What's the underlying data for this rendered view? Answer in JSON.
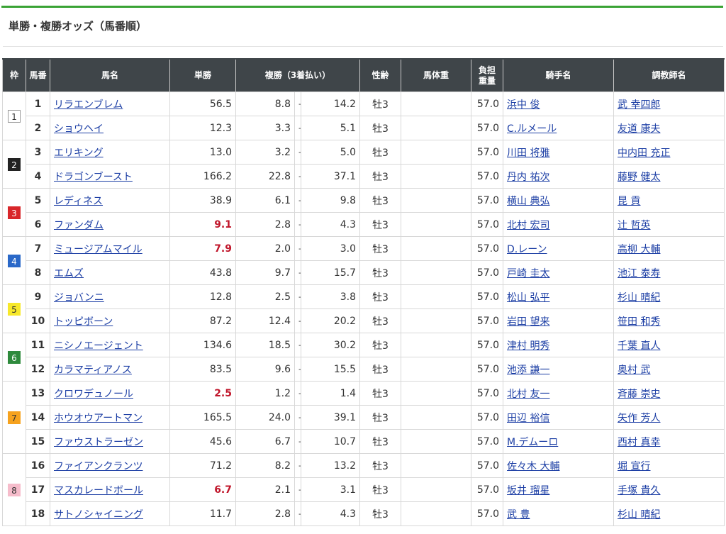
{
  "title": "単勝・複勝オッズ（馬番順）",
  "headers": {
    "waku": "枠",
    "umaban": "馬番",
    "name": "馬名",
    "tansho": "単勝",
    "fukusho": "複勝（3着払い）",
    "sexage": "性齢",
    "weight": "馬体重",
    "futan_1": "負担",
    "futan_2": "重量",
    "jockey": "騎手名",
    "trainer": "調教師名"
  },
  "fuku_separator": "-",
  "waku_colors": {
    "1": {
      "bg": "#ffffff",
      "fg": "#333333",
      "border": "#999999"
    },
    "2": {
      "bg": "#222222",
      "fg": "#ffffff",
      "border": "#222222"
    },
    "3": {
      "bg": "#d8262a",
      "fg": "#ffffff",
      "border": "#d8262a"
    },
    "4": {
      "bg": "#2a68c8",
      "fg": "#ffffff",
      "border": "#2a68c8"
    },
    "5": {
      "bg": "#f7e82a",
      "fg": "#333333",
      "border": "#f7e82a"
    },
    "6": {
      "bg": "#2e8a3c",
      "fg": "#ffffff",
      "border": "#2e8a3c"
    },
    "7": {
      "bg": "#f6a21e",
      "fg": "#333333",
      "border": "#f6a21e"
    },
    "8": {
      "bg": "#f6bccb",
      "fg": "#333333",
      "border": "#f6bccb"
    }
  },
  "accent_color": "#3aa335",
  "popular_color": "#c0152a",
  "rows": [
    {
      "waku": "1",
      "umaban": "1",
      "name": "リラエンブレム",
      "tansho": "56.5",
      "popular": false,
      "fuku_lo": "8.8",
      "fuku_hi": "14.2",
      "sexage": "牡3",
      "weight": "",
      "futan": "57.0",
      "jockey": "浜中 俊",
      "trainer": "武 幸四郎"
    },
    {
      "waku": "1",
      "umaban": "2",
      "name": "ショウヘイ",
      "tansho": "12.3",
      "popular": false,
      "fuku_lo": "3.3",
      "fuku_hi": "5.1",
      "sexage": "牡3",
      "weight": "",
      "futan": "57.0",
      "jockey": "C.ルメール",
      "trainer": "友道 康夫"
    },
    {
      "waku": "2",
      "umaban": "3",
      "name": "エリキング",
      "tansho": "13.0",
      "popular": false,
      "fuku_lo": "3.2",
      "fuku_hi": "5.0",
      "sexage": "牡3",
      "weight": "",
      "futan": "57.0",
      "jockey": "川田 将雅",
      "trainer": "中内田 充正"
    },
    {
      "waku": "2",
      "umaban": "4",
      "name": "ドラゴンブースト",
      "tansho": "166.2",
      "popular": false,
      "fuku_lo": "22.8",
      "fuku_hi": "37.1",
      "sexage": "牡3",
      "weight": "",
      "futan": "57.0",
      "jockey": "丹内 祐次",
      "trainer": "藤野 健太"
    },
    {
      "waku": "3",
      "umaban": "5",
      "name": "レディネス",
      "tansho": "38.9",
      "popular": false,
      "fuku_lo": "6.1",
      "fuku_hi": "9.8",
      "sexage": "牡3",
      "weight": "",
      "futan": "57.0",
      "jockey": "横山 典弘",
      "trainer": "昆 貢"
    },
    {
      "waku": "3",
      "umaban": "6",
      "name": "ファンダム",
      "tansho": "9.1",
      "popular": true,
      "fuku_lo": "2.8",
      "fuku_hi": "4.3",
      "sexage": "牡3",
      "weight": "",
      "futan": "57.0",
      "jockey": "北村 宏司",
      "trainer": "辻 哲英"
    },
    {
      "waku": "4",
      "umaban": "7",
      "name": "ミュージアムマイル",
      "tansho": "7.9",
      "popular": true,
      "fuku_lo": "2.0",
      "fuku_hi": "3.0",
      "sexage": "牡3",
      "weight": "",
      "futan": "57.0",
      "jockey": "D.レーン",
      "trainer": "高柳 大輔"
    },
    {
      "waku": "4",
      "umaban": "8",
      "name": "エムズ",
      "tansho": "43.8",
      "popular": false,
      "fuku_lo": "9.7",
      "fuku_hi": "15.7",
      "sexage": "牡3",
      "weight": "",
      "futan": "57.0",
      "jockey": "戸崎 圭太",
      "trainer": "池江 泰寿"
    },
    {
      "waku": "5",
      "umaban": "9",
      "name": "ジョバンニ",
      "tansho": "12.8",
      "popular": false,
      "fuku_lo": "2.5",
      "fuku_hi": "3.8",
      "sexage": "牡3",
      "weight": "",
      "futan": "57.0",
      "jockey": "松山 弘平",
      "trainer": "杉山 晴紀"
    },
    {
      "waku": "5",
      "umaban": "10",
      "name": "トッピボーン",
      "tansho": "87.2",
      "popular": false,
      "fuku_lo": "12.4",
      "fuku_hi": "20.2",
      "sexage": "牡3",
      "weight": "",
      "futan": "57.0",
      "jockey": "岩田 望来",
      "trainer": "笹田 和秀"
    },
    {
      "waku": "6",
      "umaban": "11",
      "name": "ニシノエージェント",
      "tansho": "134.6",
      "popular": false,
      "fuku_lo": "18.5",
      "fuku_hi": "30.2",
      "sexage": "牡3",
      "weight": "",
      "futan": "57.0",
      "jockey": "津村 明秀",
      "trainer": "千葉 直人"
    },
    {
      "waku": "6",
      "umaban": "12",
      "name": "カラマティアノス",
      "tansho": "83.5",
      "popular": false,
      "fuku_lo": "9.6",
      "fuku_hi": "15.5",
      "sexage": "牡3",
      "weight": "",
      "futan": "57.0",
      "jockey": "池添 謙一",
      "trainer": "奥村 武"
    },
    {
      "waku": "7",
      "umaban": "13",
      "name": "クロワデュノール",
      "tansho": "2.5",
      "popular": true,
      "fuku_lo": "1.2",
      "fuku_hi": "1.4",
      "sexage": "牡3",
      "weight": "",
      "futan": "57.0",
      "jockey": "北村 友一",
      "trainer": "斉藤 崇史"
    },
    {
      "waku": "7",
      "umaban": "14",
      "name": "ホウオウアートマン",
      "tansho": "165.5",
      "popular": false,
      "fuku_lo": "24.0",
      "fuku_hi": "39.1",
      "sexage": "牡3",
      "weight": "",
      "futan": "57.0",
      "jockey": "田辺 裕信",
      "trainer": "矢作 芳人"
    },
    {
      "waku": "7",
      "umaban": "15",
      "name": "ファウストラーゼン",
      "tansho": "45.6",
      "popular": false,
      "fuku_lo": "6.7",
      "fuku_hi": "10.7",
      "sexage": "牡3",
      "weight": "",
      "futan": "57.0",
      "jockey": "M.デムーロ",
      "trainer": "西村 真幸"
    },
    {
      "waku": "8",
      "umaban": "16",
      "name": "ファイアンクランツ",
      "tansho": "71.2",
      "popular": false,
      "fuku_lo": "8.2",
      "fuku_hi": "13.2",
      "sexage": "牡3",
      "weight": "",
      "futan": "57.0",
      "jockey": "佐々木 大輔",
      "trainer": "堀 宣行"
    },
    {
      "waku": "8",
      "umaban": "17",
      "name": "マスカレードボール",
      "tansho": "6.7",
      "popular": true,
      "fuku_lo": "2.1",
      "fuku_hi": "3.1",
      "sexage": "牡3",
      "weight": "",
      "futan": "57.0",
      "jockey": "坂井 瑠星",
      "trainer": "手塚 貴久"
    },
    {
      "waku": "8",
      "umaban": "18",
      "name": "サトノシャイニング",
      "tansho": "11.7",
      "popular": false,
      "fuku_lo": "2.8",
      "fuku_hi": "4.3",
      "sexage": "牡3",
      "weight": "",
      "futan": "57.0",
      "jockey": "武 豊",
      "trainer": "杉山 晴紀"
    }
  ]
}
